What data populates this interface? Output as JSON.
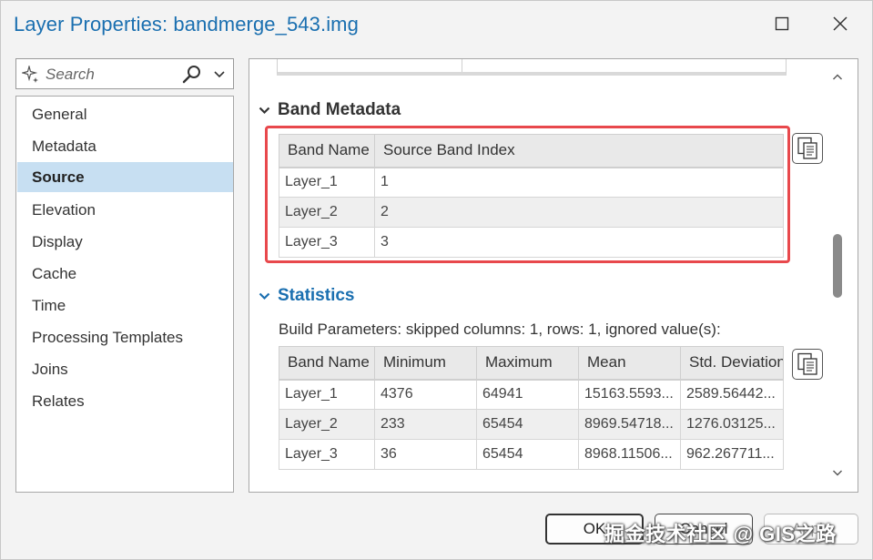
{
  "window": {
    "title": "Layer Properties: bandmerge_543.img"
  },
  "search": {
    "placeholder": "Search"
  },
  "nav": {
    "items": [
      {
        "label": "General"
      },
      {
        "label": "Metadata"
      },
      {
        "label": "Source"
      },
      {
        "label": "Elevation"
      },
      {
        "label": "Display"
      },
      {
        "label": "Cache"
      },
      {
        "label": "Time"
      },
      {
        "label": "Processing Templates"
      },
      {
        "label": "Joins"
      },
      {
        "label": "Relates"
      }
    ],
    "active": "Source"
  },
  "band_metadata": {
    "title": "Band Metadata",
    "columns": [
      "Band Name",
      "Source Band Index"
    ],
    "rows": [
      [
        "Layer_1",
        "1"
      ],
      [
        "Layer_2",
        "2"
      ],
      [
        "Layer_3",
        "3"
      ]
    ]
  },
  "statistics": {
    "title": "Statistics",
    "build_parameters": "Build Parameters: skipped columns: 1, rows: 1, ignored value(s):",
    "columns": [
      "Band Name",
      "Minimum",
      "Maximum",
      "Mean",
      "Std. Deviation"
    ],
    "rows": [
      [
        "Layer_1",
        "4376",
        "64941",
        "15163.5593...",
        "2589.56442..."
      ],
      [
        "Layer_2",
        "233",
        "65454",
        "8969.54718...",
        "1276.03125..."
      ],
      [
        "Layer_3",
        "36",
        "65454",
        "8968.11506...",
        "962.267711..."
      ]
    ]
  },
  "footer": {
    "ok_label": "OK",
    "cancel_label": "Cancel",
    "apply_label": "Apply"
  },
  "watermark": "掘金技术社区 @ GIS之路",
  "colors": {
    "title": "#1a6fb0",
    "active_nav": "#c7dff2",
    "highlight_box": "#e8484c"
  }
}
